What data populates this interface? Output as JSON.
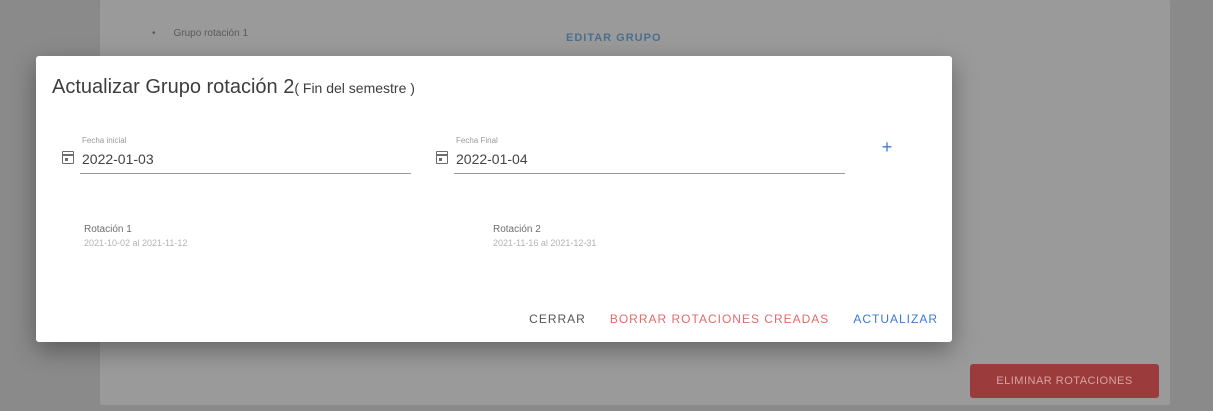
{
  "background": {
    "group_label": "Grupo rotación 1",
    "edit_group_label": "EDITAR GRUPO",
    "delete_rotations_label": "ELIMINAR ROTACIONES"
  },
  "dialog": {
    "title": "Actualizar Grupo rotación 2",
    "title_suffix": "( Fin del semestre )",
    "start_date": {
      "label": "Fecha inicial",
      "value": "2022-01-03"
    },
    "end_date": {
      "label": "Fecha Final",
      "value": "2022-01-04"
    },
    "add_symbol": "+",
    "rotations": [
      {
        "name": "Rotación 1",
        "dates": "2021-10-02 al 2021-11-12"
      },
      {
        "name": "Rotación 2",
        "dates": "2021-11-16 al 2021-12-31"
      }
    ],
    "actions": {
      "close": "CERRAR",
      "delete_created": "BORRAR ROTACIONES CREADAS",
      "update": "ACTUALIZAR"
    }
  },
  "colors": {
    "primary": "#3b7bd0",
    "danger": "#e26b6b",
    "overlay": "#8a8a8a"
  },
  "icons": [
    "calendar-icon",
    "plus-icon"
  ]
}
